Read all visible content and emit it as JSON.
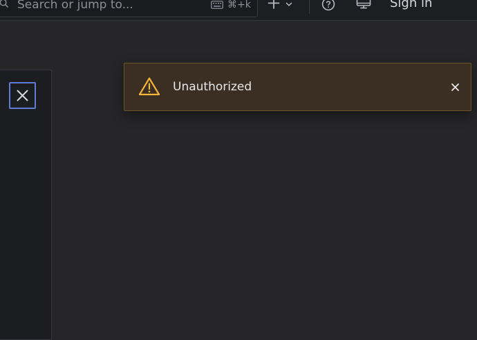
{
  "topbar": {
    "search": {
      "placeholder": "Search or jump to...",
      "icon": "search-icon",
      "shortcut_icon": "keyboard-icon",
      "shortcut_label": "⌘+k"
    },
    "add_menu": {
      "icon": "plus-icon",
      "caret_icon": "chevron-down-icon"
    },
    "help": {
      "icon": "help-icon"
    },
    "display": {
      "icon": "monitor-icon"
    },
    "sign_in_label": "Sign in"
  },
  "drawer": {
    "close_icon": "close-icon",
    "close_focus_color": "#5d7fd6"
  },
  "toast": {
    "severity": "warning",
    "icon": "warning-icon",
    "message": "Unauthorized",
    "close_icon": "close-icon",
    "accent_color": "#f5b73b",
    "background_color": "#3a2f22"
  },
  "colors": {
    "page_background": "#262628",
    "topbar_background": "#1d1e22",
    "drawer_background": "#1c1d21",
    "text_primary": "#d6d8de",
    "text_secondary": "#8c8f98"
  }
}
